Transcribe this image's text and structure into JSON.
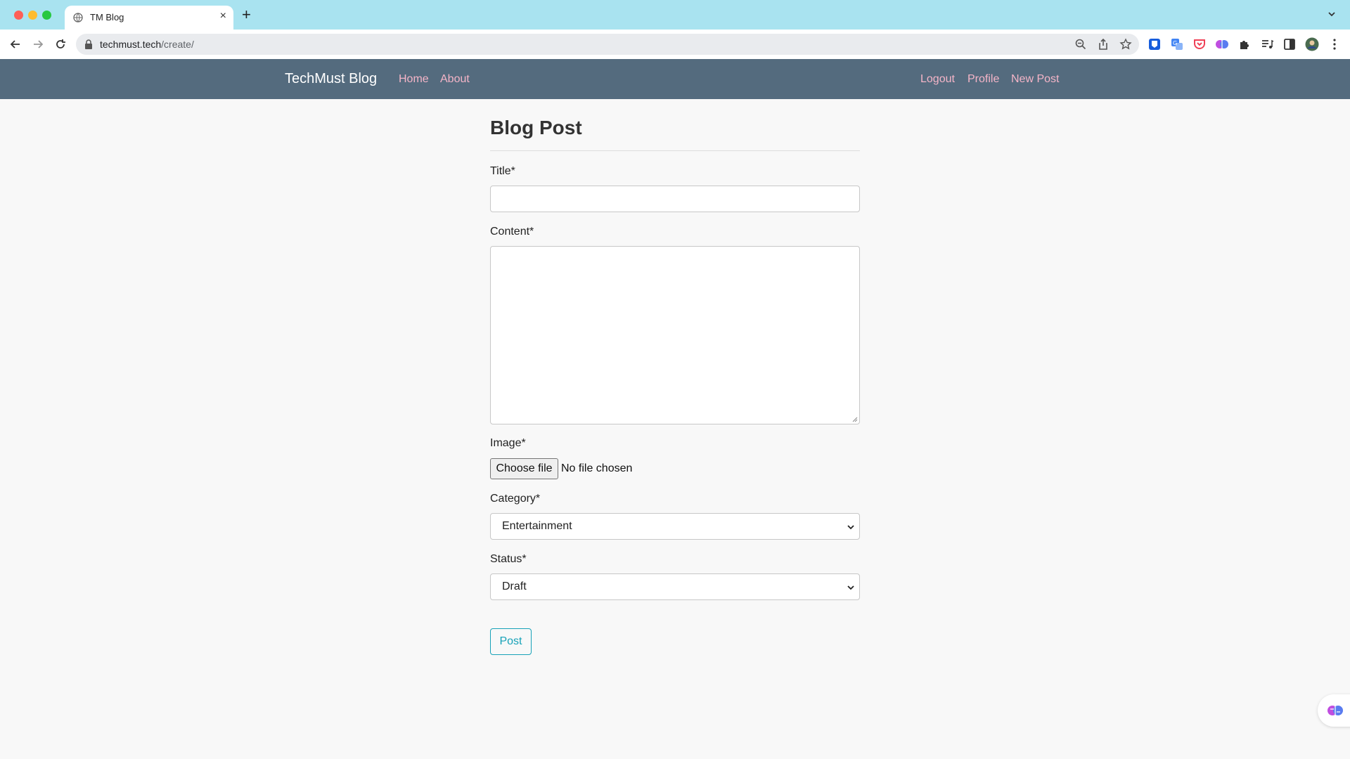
{
  "browser": {
    "tab_title": "TM Blog",
    "url_host": "techmust.tech",
    "url_path": "/create/"
  },
  "navbar": {
    "brand": "TechMust Blog",
    "left_links": [
      "Home",
      "About"
    ],
    "right_links": [
      "Logout",
      "Profile",
      "New Post"
    ]
  },
  "form": {
    "heading": "Blog Post",
    "title_label": "Title*",
    "title_value": "",
    "content_label": "Content*",
    "content_value": "",
    "image_label": "Image*",
    "choose_file_label": "Choose file",
    "file_status": "No file chosen",
    "category_label": "Category*",
    "category_value": "Entertainment",
    "status_label": "Status*",
    "status_value": "Draft",
    "submit_label": "Post"
  },
  "colors": {
    "navbar_bg": "#546b7e",
    "nav_link": "#f5b5c8",
    "accent_button": "#17a2b8",
    "tabbar_bg": "#a9e3f0"
  },
  "icons": [
    "back-arrow-icon",
    "forward-arrow-icon",
    "reload-icon",
    "lock-icon",
    "zoom-icon",
    "share-icon",
    "bookmark-star-icon",
    "extension-icons",
    "puzzle-icon",
    "media-icon",
    "sidepanel-icon",
    "profile-avatar-icon",
    "menu-dots-icon",
    "brain-icon"
  ]
}
